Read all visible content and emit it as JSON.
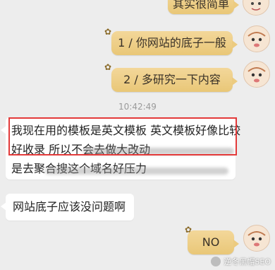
{
  "chat": {
    "outgoing": [
      {
        "text": "其实很简单"
      },
      {
        "text": "1 / 你网站的底子一般"
      },
      {
        "text": "2 / 多研究一下内容"
      },
      {
        "text": "NO"
      }
    ],
    "timestamp": "10:42:49",
    "incoming": [
      {
        "lines": [
          "我现在用的模板是英文模板 英文模板好像比较",
          "好收录 所以不会去做大改动",
          "是去聚合搜这个域名好压力"
        ]
      },
      {
        "lines": [
          "网站底子应该没问题啊"
        ]
      }
    ]
  },
  "watermark": {
    "text": "逆冬黑帽SEO"
  },
  "colors": {
    "outgoing_bubble": "#ecc97c",
    "incoming_bubble": "#ffffff",
    "highlight_box": "#e33a3a",
    "background": "#ededed"
  }
}
